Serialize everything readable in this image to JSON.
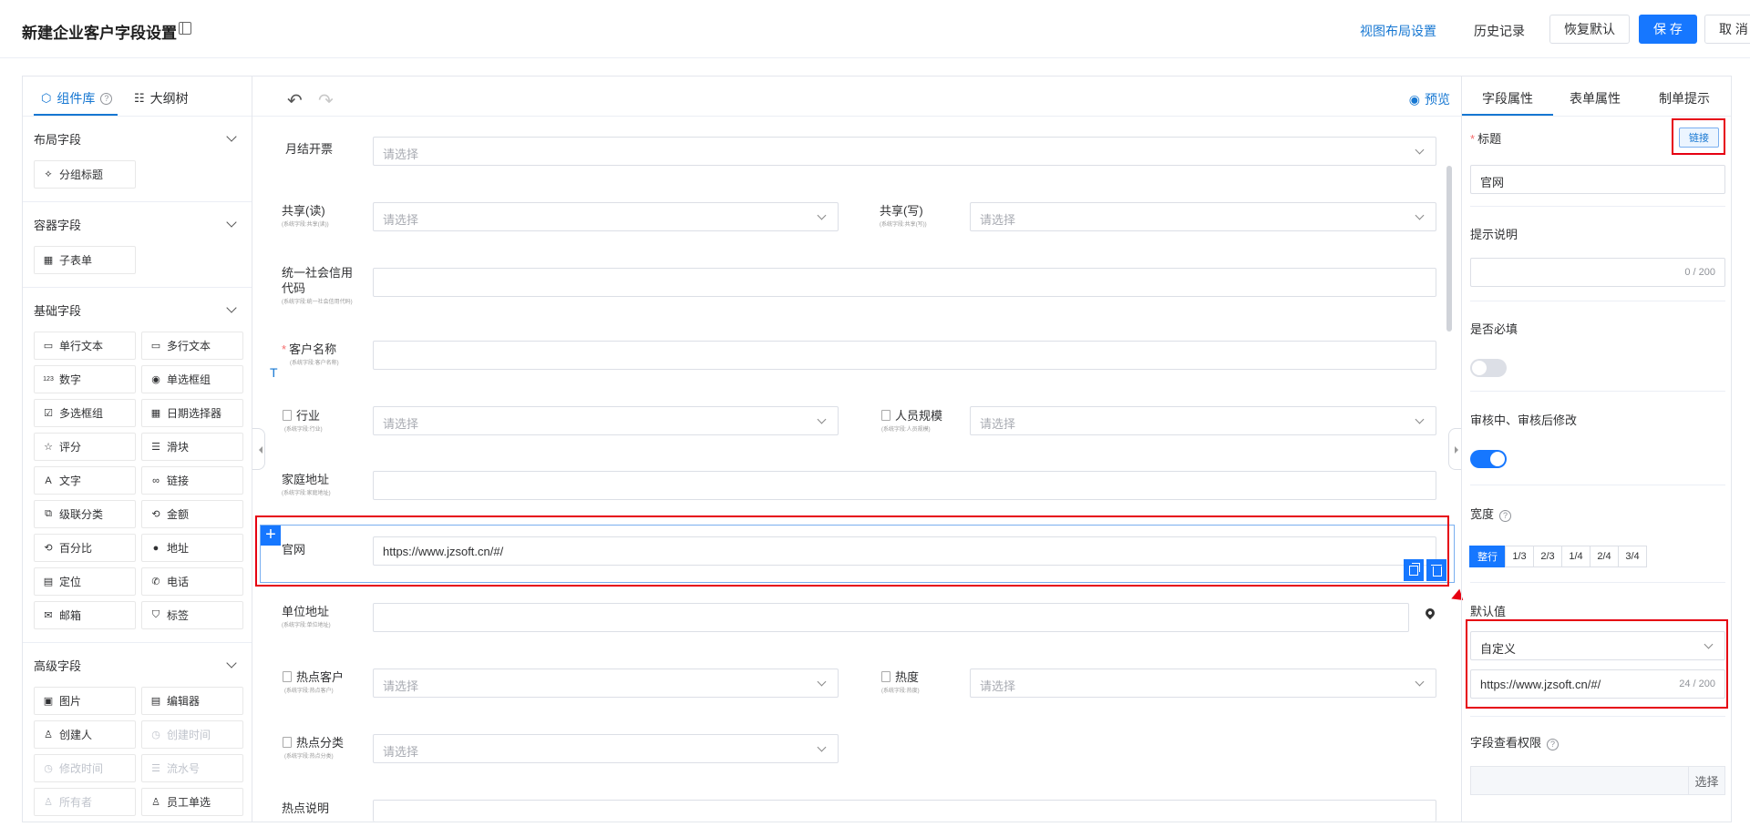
{
  "header": {
    "title": "新建企业客户字段设置",
    "view_layout": "视图布局设置",
    "history": "历史记录",
    "restore_default": "恢复默认",
    "save": "保 存",
    "cancel": "取 消"
  },
  "left_panel": {
    "tabs": [
      {
        "label": "组件库",
        "icon": "cube-icon",
        "help": "?",
        "active": true
      },
      {
        "label": "大纲树",
        "icon": "tree-icon",
        "active": false
      }
    ],
    "categories": [
      {
        "title": "布局字段",
        "items": [
          {
            "label": "分组标题",
            "icon": "group-title-icon",
            "glyph": "⟡",
            "disabled": false
          }
        ]
      },
      {
        "title": "容器字段",
        "items": [
          {
            "label": "子表单",
            "icon": "table-icon",
            "glyph": "▦",
            "disabled": false
          }
        ]
      },
      {
        "title": "基础字段",
        "items": [
          {
            "label": "单行文本",
            "icon": "single-line-icon",
            "glyph": "▭",
            "disabled": false
          },
          {
            "label": "多行文本",
            "icon": "multi-line-icon",
            "glyph": "▭",
            "disabled": false
          },
          {
            "label": "数字",
            "icon": "number-icon",
            "glyph": "123",
            "disabled": false
          },
          {
            "label": "单选框组",
            "icon": "radio-icon",
            "glyph": "◉",
            "disabled": false
          },
          {
            "label": "多选框组",
            "icon": "checkbox-icon",
            "glyph": "☑",
            "disabled": false
          },
          {
            "label": "日期选择器",
            "icon": "calendar-icon",
            "glyph": "▦",
            "disabled": false
          },
          {
            "label": "评分",
            "icon": "star-icon",
            "glyph": "☆",
            "disabled": false
          },
          {
            "label": "滑块",
            "icon": "slider-icon",
            "glyph": "☰",
            "disabled": false
          },
          {
            "label": "文字",
            "icon": "text-icon",
            "glyph": "A",
            "disabled": false
          },
          {
            "label": "链接",
            "icon": "link-icon",
            "glyph": "∞",
            "disabled": false
          },
          {
            "label": "级联分类",
            "icon": "cascade-icon",
            "glyph": "⧉",
            "disabled": false
          },
          {
            "label": "金额",
            "icon": "money-icon",
            "glyph": "⟲",
            "disabled": false
          },
          {
            "label": "百分比",
            "icon": "percent-icon",
            "glyph": "⟲",
            "disabled": false
          },
          {
            "label": "地址",
            "icon": "location-pin-icon",
            "glyph": "●",
            "disabled": false
          },
          {
            "label": "定位",
            "icon": "locate-icon",
            "glyph": "▤",
            "disabled": false
          },
          {
            "label": "电话",
            "icon": "phone-icon",
            "glyph": "✆",
            "disabled": false
          },
          {
            "label": "邮箱",
            "icon": "mail-icon",
            "glyph": "✉",
            "disabled": false
          },
          {
            "label": "标签",
            "icon": "tag-icon",
            "glyph": "⛉",
            "disabled": false
          }
        ]
      },
      {
        "title": "高级字段",
        "items": [
          {
            "label": "图片",
            "icon": "image-icon",
            "glyph": "▣",
            "disabled": false
          },
          {
            "label": "编辑器",
            "icon": "editor-icon",
            "glyph": "▤",
            "disabled": false
          },
          {
            "label": "创建人",
            "icon": "user-icon",
            "glyph": "♙",
            "disabled": false
          },
          {
            "label": "创建时间",
            "icon": "clock-icon",
            "glyph": "◷",
            "disabled": true
          },
          {
            "label": "修改时间",
            "icon": "clock-icon",
            "glyph": "◷",
            "disabled": true
          },
          {
            "label": "流水号",
            "icon": "serial-icon",
            "glyph": "☰",
            "disabled": true
          },
          {
            "label": "所有者",
            "icon": "owner-icon",
            "glyph": "♙",
            "disabled": true
          },
          {
            "label": "员工单选",
            "icon": "employee-icon",
            "glyph": "♙",
            "disabled": false
          }
        ]
      }
    ]
  },
  "toolbar": {
    "preview": "预览"
  },
  "form": {
    "placeholder": "请选择",
    "fields": {
      "monthly_invoice": {
        "label": "月结开票"
      },
      "share_read": {
        "label": "共享(读)",
        "sub": "(系统字段:共享(读))"
      },
      "share_write": {
        "label": "共享(写)",
        "sub": "(系统字段:共享(写))"
      },
      "credit_code": {
        "label1": "统一社会信用",
        "label2": "代码",
        "sub": "(系统字段:统一社会信用代码)"
      },
      "customer_name": {
        "label": "客户名称",
        "required": "*",
        "sub": "(系统字段:客户名称)"
      },
      "industry": {
        "label": "行业",
        "sub": "(系统字段:行业)"
      },
      "staff_size": {
        "label": "人员规模",
        "sub": "(系统字段:人员规模)"
      },
      "home_address": {
        "label": "家庭地址",
        "sub": "(系统字段:家庭地址)"
      },
      "website": {
        "label": "官网",
        "value": "https://www.jzsoft.cn/#/"
      },
      "work_address": {
        "label": "单位地址",
        "sub": "(系统字段:单位地址)"
      },
      "hot_customer": {
        "label": "热点客户",
        "sub": "(系统字段:热点客户)"
      },
      "heat": {
        "label": "热度",
        "sub": "(系统字段:热度)"
      },
      "hot_category": {
        "label": "热点分类",
        "sub": "(系统字段:热点分类)"
      },
      "hot_note": {
        "label": "热点说明"
      }
    },
    "text_marker": "T"
  },
  "right_panel": {
    "tabs": [
      "字段属性",
      "表单属性",
      "制单提示"
    ],
    "title_label": "标题",
    "required_mark": "*",
    "link_button": "链接",
    "title_value": "官网",
    "hint_label": "提示说明",
    "hint_count": "0 / 200",
    "required_label": "是否必填",
    "required_on": false,
    "review_label": "审核中、审核后修改",
    "review_on": true,
    "width_label": "宽度",
    "width_options": [
      "整行",
      "1/3",
      "2/3",
      "1/4",
      "2/4",
      "3/4"
    ],
    "width_selected": "整行",
    "default_label": "默认值",
    "default_type": "自定义",
    "default_value": "https://www.jzsoft.cn/#/",
    "default_count": "24 / 200",
    "perm_label": "字段查看权限",
    "perm_button": "选择"
  },
  "colors": {
    "primary": "#1677ff",
    "highlight": "#e60012"
  }
}
